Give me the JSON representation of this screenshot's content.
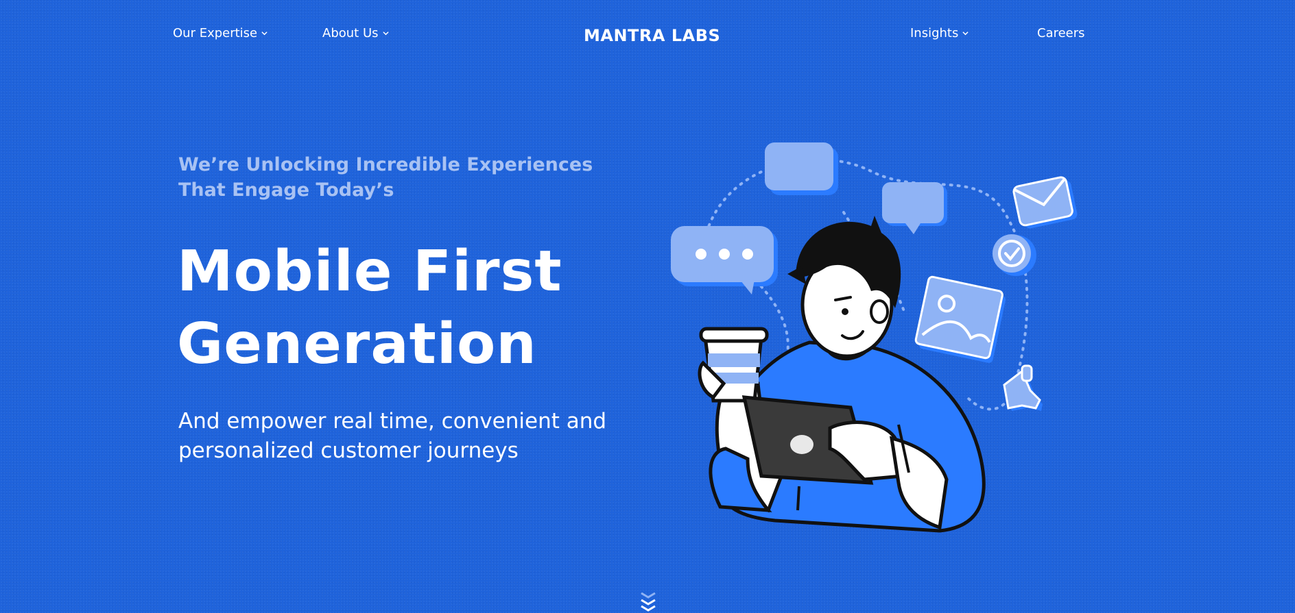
{
  "nav": {
    "left": [
      {
        "label": "Our Expertise",
        "has_dropdown": true
      },
      {
        "label": "About Us",
        "has_dropdown": true
      }
    ],
    "logo": "MANTRA LABS",
    "right": [
      {
        "label": "Insights",
        "has_dropdown": true
      },
      {
        "label": "Careers",
        "has_dropdown": false
      }
    ]
  },
  "hero": {
    "eyebrow_line1": "We’re Unlocking Incredible Experiences",
    "eyebrow_line2": "That Engage Today’s",
    "headline_line1": "Mobile First",
    "headline_line2": "Generation",
    "sub_line1": "And empower real time, convenient and",
    "sub_line2": "personalized customer journeys"
  },
  "colors": {
    "background": "#1f63db",
    "eyebrow": "#a8c2f3",
    "text": "#ffffff",
    "illustration_light": "#8fb3f5",
    "illustration_accent": "#2b7bff"
  },
  "icons": [
    "chevron-down-icon",
    "scroll-down-icon"
  ]
}
